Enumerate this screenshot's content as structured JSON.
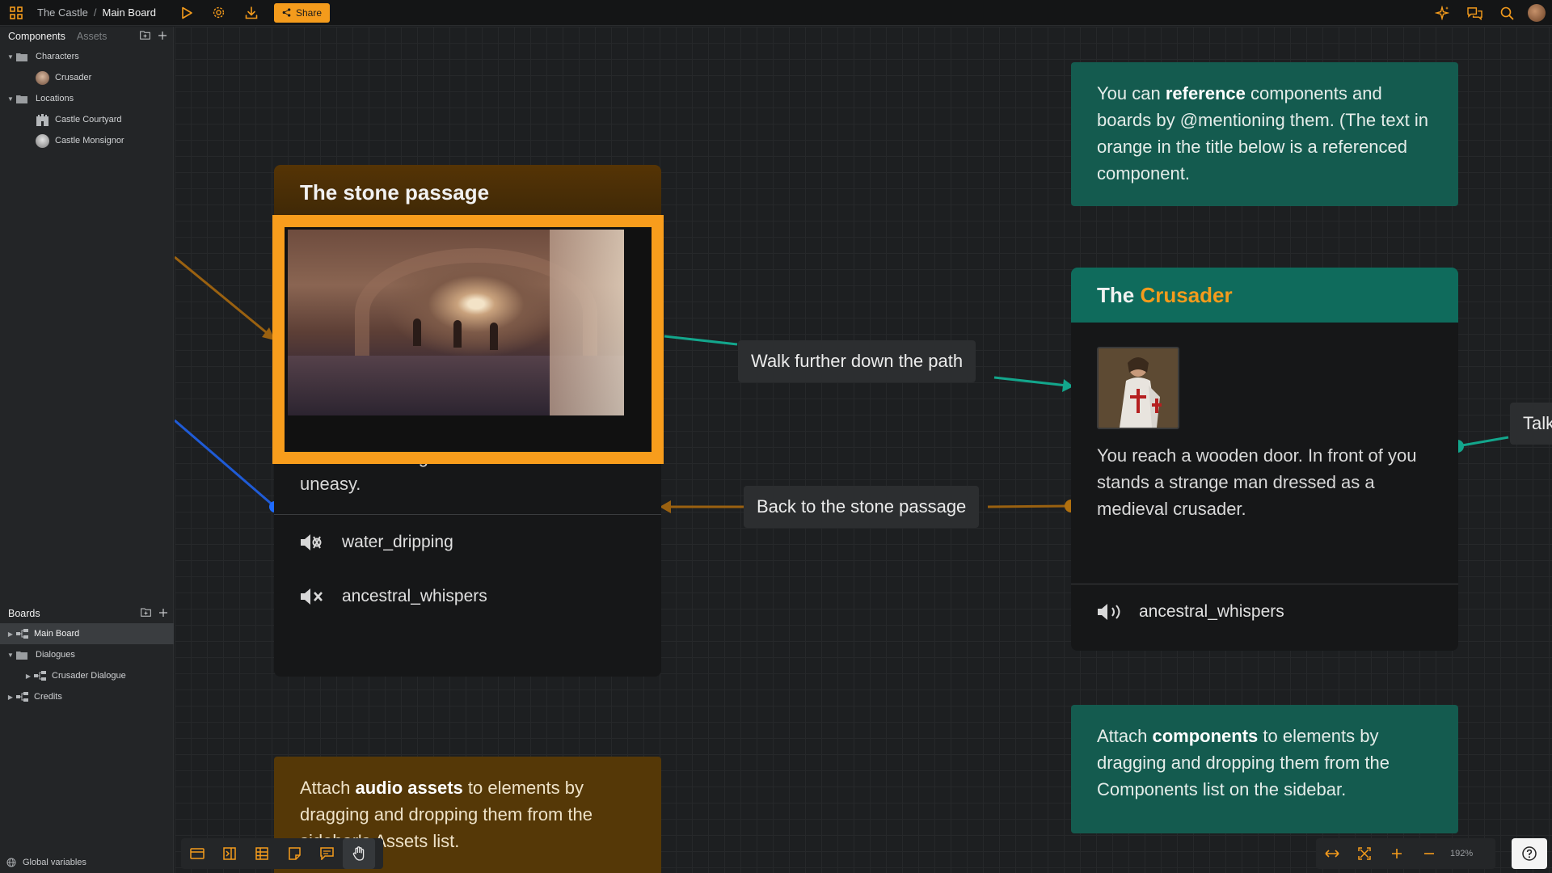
{
  "topbar": {
    "project": "The Castle",
    "separator": "/",
    "board": "Main Board",
    "share_label": "Share"
  },
  "sidebar": {
    "tabs": [
      "Components",
      "Assets"
    ],
    "components": [
      {
        "label": "Characters",
        "type": "folder"
      },
      {
        "label": "Crusader",
        "type": "character"
      },
      {
        "label": "Locations",
        "type": "folder"
      },
      {
        "label": "Castle Courtyard",
        "type": "location"
      },
      {
        "label": "Castle Monsignor",
        "type": "location"
      }
    ],
    "boards_title": "Boards",
    "boards": [
      {
        "label": "Main Board"
      },
      {
        "label": "Dialogues"
      },
      {
        "label": "Crusader Dialogue"
      },
      {
        "label": "Credits"
      }
    ],
    "global_variables": "Global variables"
  },
  "canvas": {
    "stone_node": {
      "title": "The stone passage",
      "body": "A stone passage. The sound of dripping water is echoing in the distance. You feel uneasy.",
      "audio": [
        "water_dripping",
        "ancestral_whispers"
      ]
    },
    "crusader_node": {
      "title_prefix": "The",
      "title_ref": "Crusader",
      "body": "You reach a wooden door. In front of you stands a strange man dressed as a medieval crusader.",
      "audio": [
        "ancestral_whispers"
      ]
    },
    "edge_labels": {
      "walk": "Walk further down the path",
      "back": "Back to the stone passage",
      "talk": "Talk"
    },
    "note_reference": {
      "pre": "You can ",
      "bold": "reference",
      "post": " components and boards by @mentioning them. (The text in orange in the title below is a referenced component."
    },
    "note_components": {
      "pre": "Attach ",
      "bold": "components",
      "post": " to elements by dragging and dropping them from the Components list on the sidebar."
    },
    "note_audio": {
      "pre": "Attach ",
      "bold": "audio assets",
      "post": " to elements by dragging and dropping them from the sidebar's Assets list."
    }
  },
  "zoom": {
    "level": "192%"
  },
  "colors": {
    "accent_orange": "#f89d1c",
    "teal": "#145b4f",
    "teal_header": "#0f6b5c",
    "wire_teal": "#13a68c",
    "wire_orange": "#9a6110",
    "wire_blue": "#1f5bd6"
  }
}
